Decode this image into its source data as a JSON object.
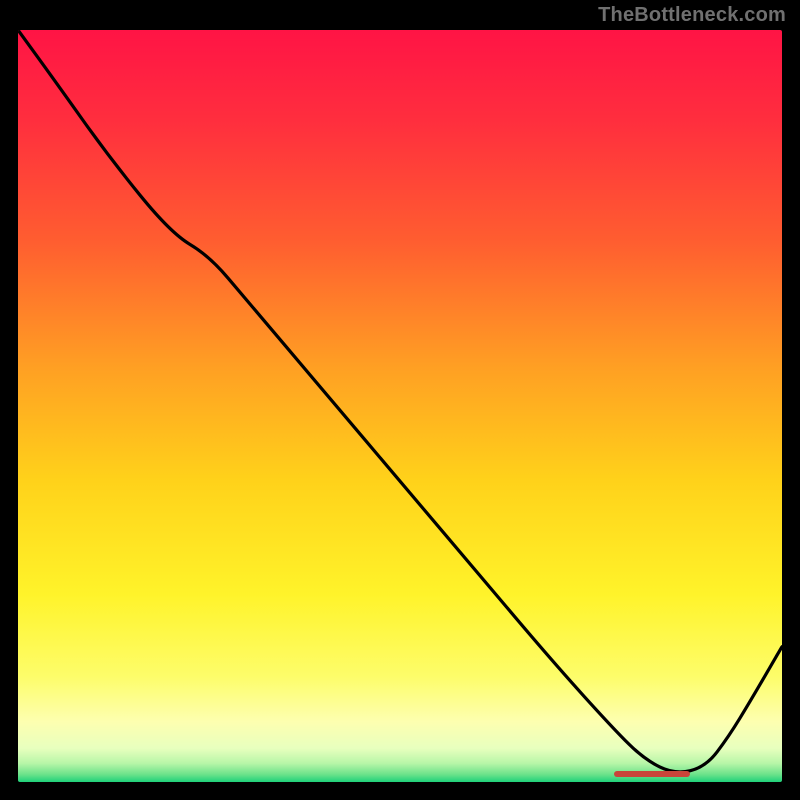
{
  "watermark": "TheBottleneck.com",
  "colors": {
    "bg": "#000000",
    "watermark": "#707070",
    "curve": "#000000",
    "red_bar": "#c9453a",
    "gradient_stops": [
      {
        "offset": 0.0,
        "color": "#ff1445"
      },
      {
        "offset": 0.12,
        "color": "#ff2e3e"
      },
      {
        "offset": 0.28,
        "color": "#ff5d30"
      },
      {
        "offset": 0.45,
        "color": "#ffa023"
      },
      {
        "offset": 0.6,
        "color": "#ffd21a"
      },
      {
        "offset": 0.75,
        "color": "#fff32a"
      },
      {
        "offset": 0.86,
        "color": "#fdfd6a"
      },
      {
        "offset": 0.92,
        "color": "#fdffb0"
      },
      {
        "offset": 0.955,
        "color": "#e8ffbe"
      },
      {
        "offset": 0.975,
        "color": "#b8f6a8"
      },
      {
        "offset": 0.99,
        "color": "#6be28a"
      },
      {
        "offset": 1.0,
        "color": "#1fd17a"
      }
    ]
  },
  "chart_data": {
    "type": "line",
    "title": "",
    "xlabel": "",
    "ylabel": "",
    "x_range": [
      0,
      100
    ],
    "y_range": [
      0,
      100
    ],
    "series": [
      {
        "name": "bottleneck-curve",
        "x": [
          0,
          5,
          12,
          20,
          25,
          30,
          40,
          50,
          60,
          70,
          78,
          82,
          86,
          90,
          93,
          96,
          100
        ],
        "values": [
          100,
          93,
          83,
          73,
          70,
          64,
          52,
          40,
          28,
          16,
          7,
          3,
          1,
          2,
          6,
          11,
          18
        ]
      }
    ],
    "annotations": [
      {
        "name": "optimal-range",
        "x_start": 78,
        "x_end": 88,
        "y": 1
      }
    ]
  }
}
